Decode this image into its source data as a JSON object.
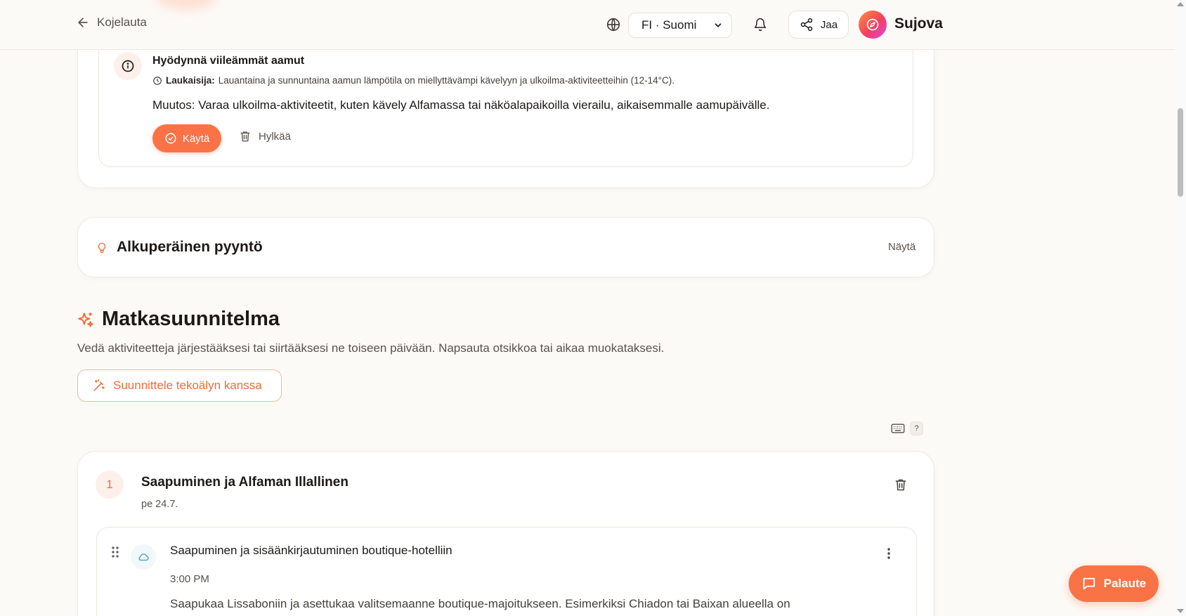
{
  "header": {
    "back_label": "Kojelauta",
    "language": "FI · Suomi",
    "share_label": "Jaa",
    "brand": "Sujova"
  },
  "suggestion": {
    "title": "Hyödynnä viileämmät aamut",
    "trigger_label": "Laukaisija:",
    "trigger_text": "Lauantaina ja sunnuntaina aamun lämpötila on miellyttävämpi kävelyyn ja ulkoilma-aktiviteetteihin (12-14°C).",
    "change_label": "Muutos:",
    "change_text": "Varaa ulkoilma-aktiviteetit, kuten kävely Alfamassa tai näköalapaikoilla vierailu, aikaisemmalle aamupäivälle.",
    "apply_label": "Käytä",
    "reject_label": "Hylkää"
  },
  "original_request": {
    "title": "Alkuperäinen pyyntö",
    "toggle_label": "Näytä"
  },
  "itinerary": {
    "title": "Matkasuunnitelma",
    "description": "Vedä aktiviteetteja järjestääksesi tai siirtääksesi ne toiseen päivään. Napsauta otsikkoa tai aikaa muokataksesi.",
    "ai_button_label": "Suunnittele tekoälyn kanssa",
    "help_label": "?"
  },
  "days": [
    {
      "number": "1",
      "title": "Saapuminen ja Alfaman Illallinen",
      "date": "pe 24.7.",
      "activities": [
        {
          "title": "Saapuminen ja sisäänkirjautuminen boutique-hotelliin",
          "time": "3:00 PM",
          "description": "Saapukaa Lissaboniin ja asettukaa valitsemaanne boutique-majoitukseen. Esimerkiksi Chiadon tai Baixan alueella on"
        }
      ]
    }
  ],
  "feedback_label": "Palaute",
  "colors": {
    "accent": "#f97347",
    "accent_text": "#f26b3a",
    "background": "#fcfaf7"
  }
}
